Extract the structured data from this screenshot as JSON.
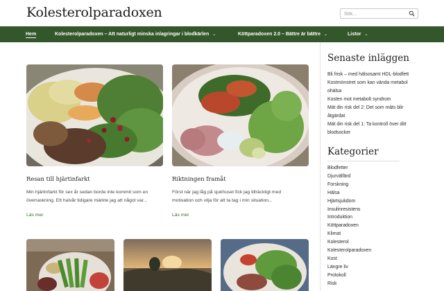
{
  "header": {
    "site_title": "Kolesterolparadoxen",
    "search_placeholder": "Sök..."
  },
  "nav": {
    "items": [
      {
        "label": "Hem",
        "active": true,
        "has_dropdown": false
      },
      {
        "label": "Kolesterolparadoxen – Att naturligt minska inlagringar i blodkärlen",
        "has_dropdown": true
      },
      {
        "label": "Köttparadoxen 2.0 – Bättre är bättre",
        "has_dropdown": true
      },
      {
        "label": "Listor",
        "has_dropdown": true
      }
    ],
    "chevron": "⌄"
  },
  "posts": [
    {
      "title": "Resan till hjärtinfarkt",
      "excerpt_line1": "Min hjärtinfarkt för sex år sedan borde inte kommit som en",
      "excerpt_line2": "överraskning. Ett halvår tidigare märkte jag att något var...",
      "more": "Läs mer",
      "image": "plate-with-kale-meat-and-root-vegetables"
    },
    {
      "title": "Riktningen framåt",
      "excerpt_line1": "Först när jag låg på sjukhuset fick jag tillräckligt med",
      "excerpt_line2": "motivation och vilja för att ta tag i min situation...",
      "more": "Läs mer",
      "image": "plate-with-salad-salmon-and-avocado"
    },
    {
      "image": "plate-with-asparagus-on-wooden-deck"
    },
    {
      "image": "sunset-over-lake"
    },
    {
      "image": "plate-with-meat-and-green-salad"
    }
  ],
  "sidebar": {
    "recent_heading": "Senaste inläggen",
    "recent": [
      "Bli frisk – med hälsosamt HDL-blodfett",
      "Kostmönstret som kan vända metabol",
      "ohälsa",
      "Kosten mot metabolt syndrom",
      "Mät din risk del 2: Det som mäts blir",
      "åtgärdat",
      "Mät din risk del 1: Ta kontroll över ditt",
      "blodsocker"
    ],
    "categories_heading": "Kategorier",
    "categories": [
      "Blodfetter",
      "Djurvälfärd",
      "Forskning",
      "Hälsa",
      "Hjärtsjukdom",
      "Insulinresistens",
      "Introduktion",
      "Köttparadoxen",
      "Klimat",
      "Kolesterol",
      "Kolesterolparadoxen",
      "Kost",
      "Längre liv",
      "Protokoll",
      "Risk"
    ]
  },
  "colors": {
    "nav_bg": "#33562a",
    "link_green": "#3b6b2e"
  }
}
